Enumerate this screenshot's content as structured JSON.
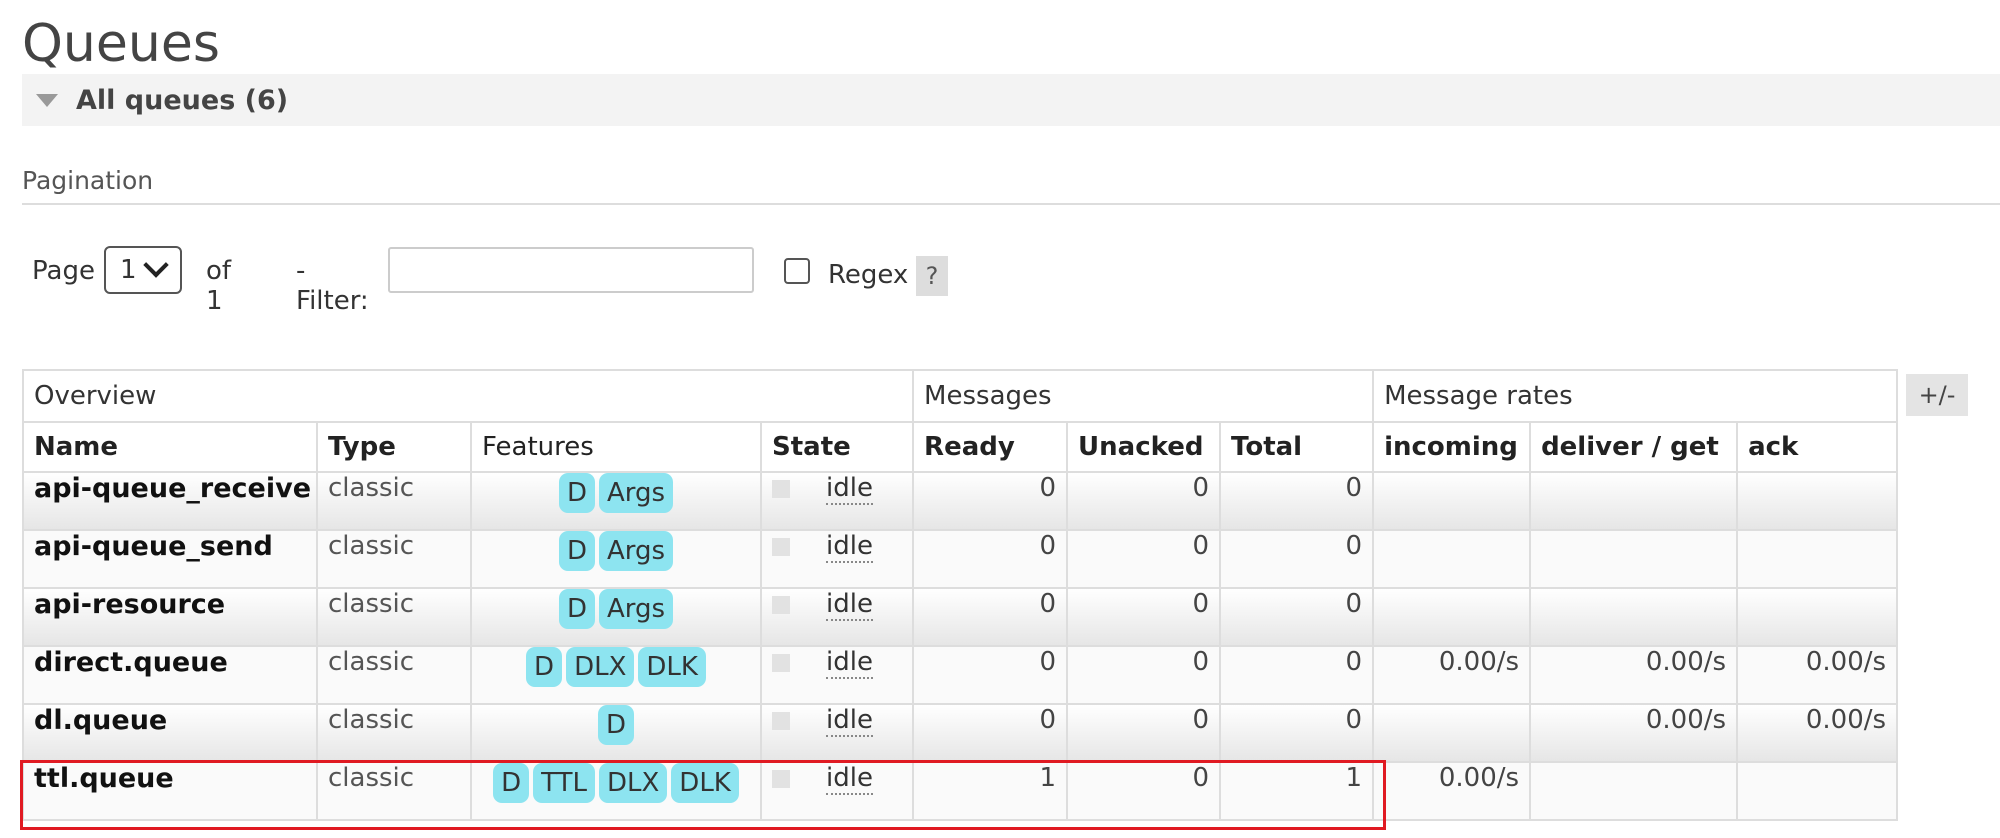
{
  "page": {
    "title": "Queues"
  },
  "section": {
    "label": "All queues (6)"
  },
  "pagination": {
    "label": "Pagination",
    "page_label": "Page",
    "page_value": "1",
    "of_label": "of 1",
    "filter_label": "- Filter:",
    "filter_value": "",
    "regex_label": "Regex",
    "help_label": "?"
  },
  "table": {
    "groups": [
      "Overview",
      "Messages",
      "Message rates"
    ],
    "columns": [
      "Name",
      "Type",
      "Features",
      "State",
      "Ready",
      "Unacked",
      "Total",
      "incoming",
      "deliver / get",
      "ack"
    ],
    "toggle_label": "+/-",
    "rows": [
      {
        "name": "api-queue_receive",
        "type": "classic",
        "features": [
          "D",
          "Args"
        ],
        "state": "idle",
        "ready": "0",
        "unacked": "0",
        "total": "0",
        "incoming": "",
        "deliver_get": "",
        "ack": ""
      },
      {
        "name": "api-queue_send",
        "type": "classic",
        "features": [
          "D",
          "Args"
        ],
        "state": "idle",
        "ready": "0",
        "unacked": "0",
        "total": "0",
        "incoming": "",
        "deliver_get": "",
        "ack": ""
      },
      {
        "name": "api-resource",
        "type": "classic",
        "features": [
          "D",
          "Args"
        ],
        "state": "idle",
        "ready": "0",
        "unacked": "0",
        "total": "0",
        "incoming": "",
        "deliver_get": "",
        "ack": ""
      },
      {
        "name": "direct.queue",
        "type": "classic",
        "features": [
          "D",
          "DLX",
          "DLK"
        ],
        "state": "idle",
        "ready": "0",
        "unacked": "0",
        "total": "0",
        "incoming": "0.00/s",
        "deliver_get": "0.00/s",
        "ack": "0.00/s"
      },
      {
        "name": "dl.queue",
        "type": "classic",
        "features": [
          "D"
        ],
        "state": "idle",
        "ready": "0",
        "unacked": "0",
        "total": "0",
        "incoming": "",
        "deliver_get": "0.00/s",
        "ack": "0.00/s"
      },
      {
        "name": "ttl.queue",
        "type": "classic",
        "features": [
          "D",
          "TTL",
          "DLX",
          "DLK"
        ],
        "state": "idle",
        "ready": "1",
        "unacked": "0",
        "total": "1",
        "incoming": "0.00/s",
        "deliver_get": "",
        "ack": ""
      }
    ]
  },
  "colors": {
    "badge": "#8de4f0",
    "highlight": "#e01a22"
  }
}
